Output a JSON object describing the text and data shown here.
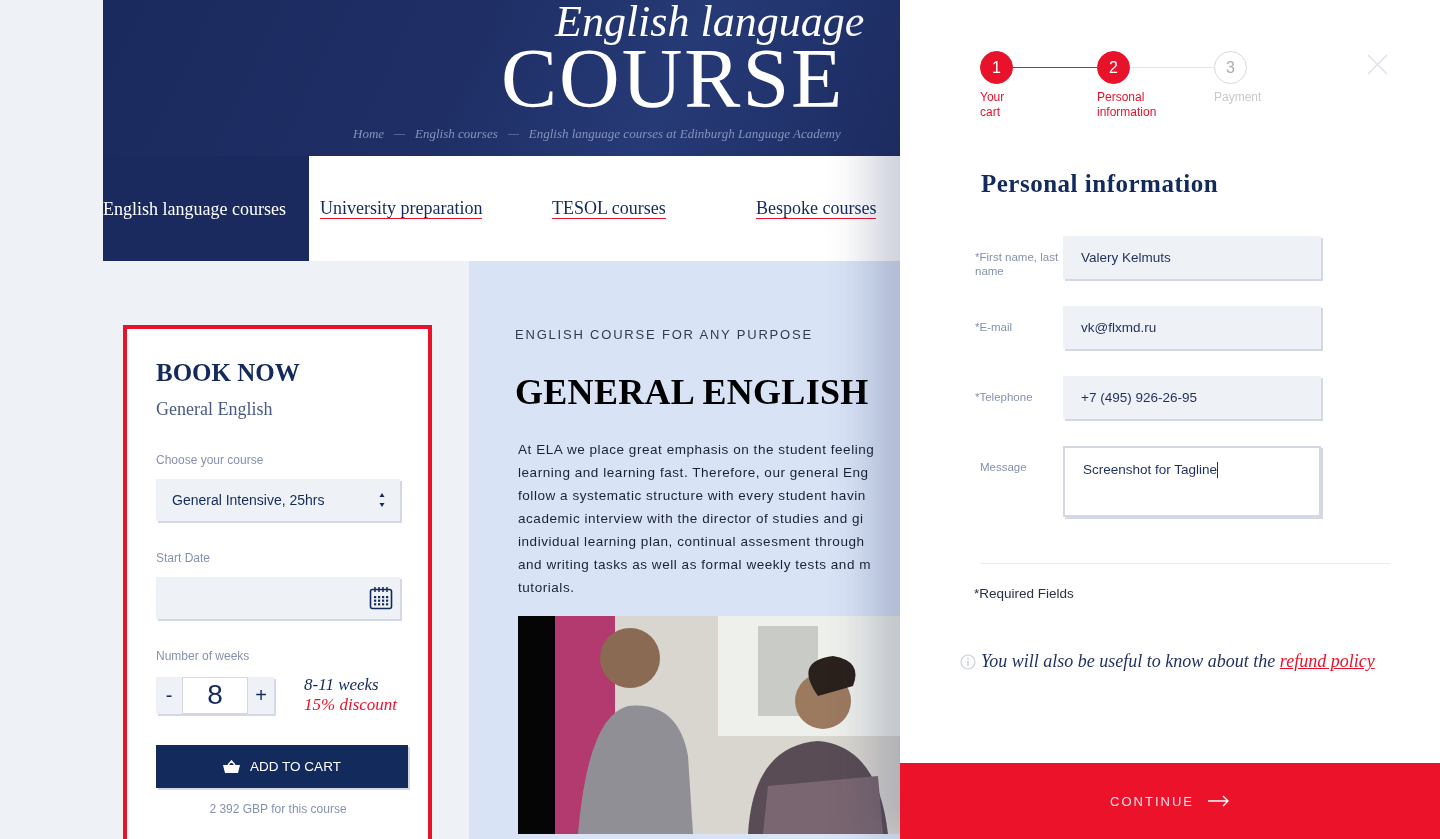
{
  "hero": {
    "script_title": "English language",
    "title": "COURSE",
    "breadcrumb": [
      "Home",
      "English courses",
      "English language courses at Edinburgh Language Academy"
    ]
  },
  "nav_tabs": [
    {
      "label": "English language courses",
      "selected": true
    },
    {
      "label": "University preparation",
      "selected": false
    },
    {
      "label": "TESOL courses",
      "selected": false
    },
    {
      "label": "Bespoke courses",
      "selected": false
    }
  ],
  "booking": {
    "title": "BOOK NOW",
    "subtitle": "General English",
    "course_label": "Choose your course",
    "course_value": "General Intensive, 25hrs",
    "date_label": "Start Date",
    "weeks_label": "Number of weeks",
    "minus": "-",
    "weeks": "8",
    "plus": "+",
    "weeks_range": "8-11 weeks",
    "discount": "15% discount",
    "add_button": "ADD TO CART",
    "price_note": "2 392 GBP for this course"
  },
  "article": {
    "kicker": "ENGLISH COURSE FOR ANY PURPOSE",
    "heading": "GENERAL ENGLISH",
    "lines": [
      "At ELA we place great emphasis on the student feeling",
      "learning and learning fast. Therefore, our general Eng",
      "follow a systematic structure with every student havin",
      "academic interview with the director of studies and gi",
      "individual learning plan, continual assesment through",
      "and writing tasks as well as formal weekly tests and m",
      "tutorials."
    ]
  },
  "checkout": {
    "steps": [
      {
        "number": "1",
        "label": "Your cart",
        "completed": true
      },
      {
        "number": "2",
        "label": "Personal information",
        "completed": true
      },
      {
        "number": "3",
        "label": "Payment",
        "completed": false
      }
    ],
    "heading": "Personal information",
    "fields": [
      {
        "label": "*First name, last name",
        "value": "Valery Kelmuts",
        "kind": "text"
      },
      {
        "label": "*E-mail",
        "value": "vk@flxmd.ru",
        "kind": "text"
      },
      {
        "label": "*Telephone",
        "value": "+7 (495) 926-26-95",
        "kind": "text"
      },
      {
        "label": "Message",
        "value": "Screenshot for Tagline",
        "kind": "textarea"
      }
    ],
    "required_note": "*Required Fields",
    "info_text": "You will also be useful to know about the",
    "info_link": "refund policy",
    "continue_button": "CONTINUE"
  }
}
